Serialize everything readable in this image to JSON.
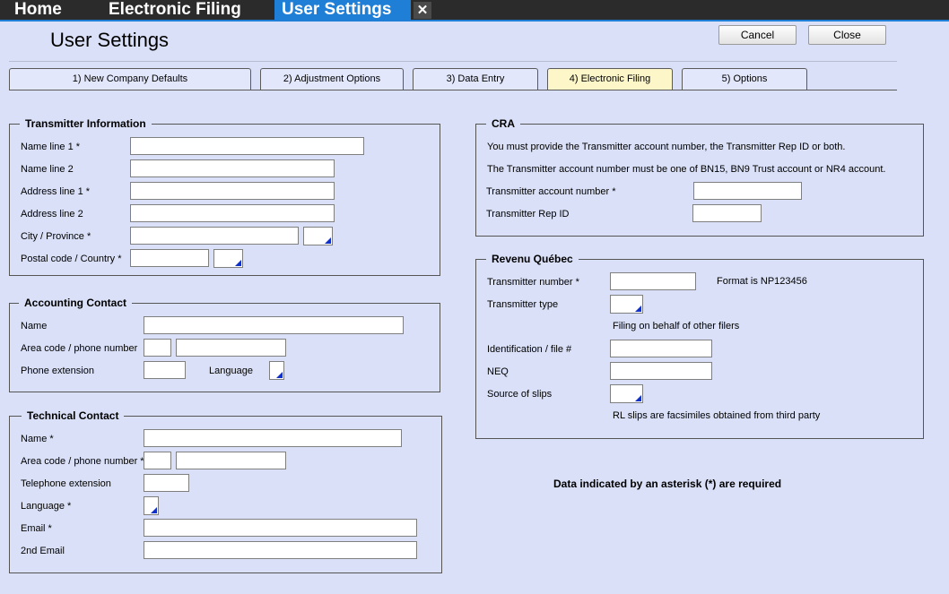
{
  "topbar": {
    "home": "Home",
    "electronic_filing": "Electronic Filing",
    "user_settings": "User Settings",
    "close_glyph": "✕"
  },
  "page": {
    "title": "User Settings"
  },
  "buttons": {
    "cancel": "Cancel",
    "close": "Close"
  },
  "tabs": [
    {
      "label": "1) New Company Defaults"
    },
    {
      "label": "2) Adjustment Options"
    },
    {
      "label": "3) Data Entry"
    },
    {
      "label": "4) Electronic Filing",
      "active": true
    },
    {
      "label": "5) Options"
    }
  ],
  "transmitter": {
    "legend": "Transmitter Information",
    "name1": "Name line 1 *",
    "name2": "Name line 2",
    "addr1": "Address line 1 *",
    "addr2": "Address line 2",
    "city": "City / Province *",
    "postal": "Postal code / Country *"
  },
  "accounting": {
    "legend": "Accounting Contact",
    "name": "Name",
    "phone": "Area code / phone number",
    "ext": "Phone extension",
    "language": "Language"
  },
  "technical": {
    "legend": "Technical Contact",
    "name": "Name *",
    "phone": "Area code / phone number *",
    "ext": "Telephone extension",
    "language": "Language *",
    "email": "Email *",
    "email2": "2nd Email"
  },
  "cra": {
    "legend": "CRA",
    "note1": "You must provide the Transmitter account number, the Transmitter Rep ID or both.",
    "note2": "The Transmitter account number must be one of BN15, BN9 Trust account or NR4 account.",
    "account": "Transmitter account number *",
    "rep_id": "Transmitter Rep ID"
  },
  "rq": {
    "legend": "Revenu Québec",
    "number": "Transmitter number *",
    "format": "Format is NP123456",
    "type": "Transmitter type",
    "type_note": "Filing on behalf of other filers",
    "ident": "Identification / file #",
    "neq": "NEQ",
    "source": "Source of slips",
    "source_note": "RL slips are facsimiles obtained from third party"
  },
  "footer": {
    "required": "Data indicated by an asterisk (*) are required"
  },
  "colors": {
    "background": "#d9e0f7",
    "accent": "#1f7fd6",
    "active_tab": "#fdf6c8"
  }
}
